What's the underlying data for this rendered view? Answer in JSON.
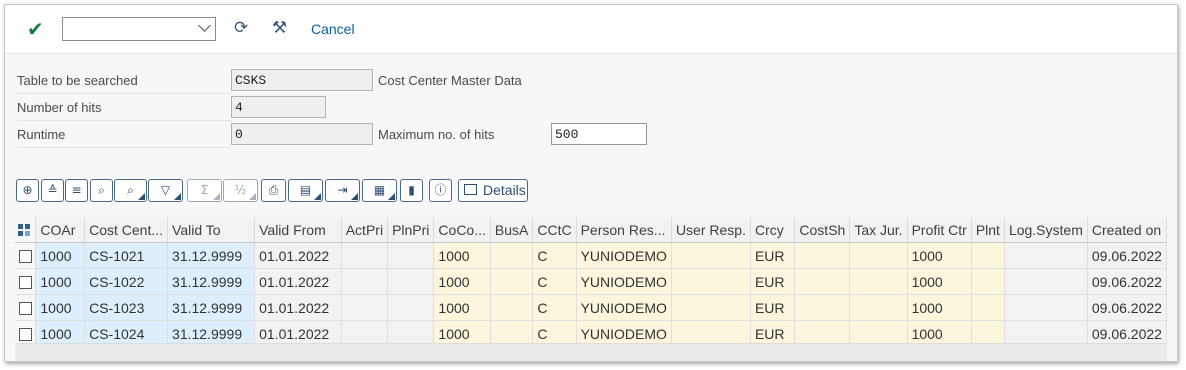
{
  "toolbar": {
    "check_glyph": "✔",
    "combo_value": "",
    "refresh_glyph": "⟳",
    "settings_glyph": "⚒",
    "cancel_label": "Cancel"
  },
  "form": {
    "table_label": "Table to be searched",
    "table_value": "CSKS",
    "table_desc": "Cost Center Master Data",
    "hits_label": "Number of hits",
    "hits_value": "4",
    "runtime_label": "Runtime",
    "runtime_value": "0",
    "maxhits_label": "Maximum no. of hits",
    "maxhits_value": "500"
  },
  "alv_toolbar": {
    "buttons": [
      {
        "icon": "zoom-icon",
        "glyph": "⊕"
      },
      {
        "icon": "sort-asc-icon",
        "glyph": "≙"
      },
      {
        "icon": "sort-desc-icon",
        "glyph": "≡"
      },
      {
        "icon": "find-icon",
        "glyph": "⌕"
      },
      {
        "icon": "find-next-icon",
        "glyph": "⌕"
      },
      {
        "icon": "filter-icon",
        "glyph": "▽"
      },
      {
        "icon": "sum-icon",
        "glyph": "Σ"
      },
      {
        "icon": "subtotal-icon",
        "glyph": "½"
      },
      {
        "icon": "print-icon",
        "glyph": "⎙"
      },
      {
        "icon": "print-preview-icon",
        "glyph": "▤"
      },
      {
        "icon": "export-icon",
        "glyph": "⇥"
      },
      {
        "icon": "layout-icon",
        "glyph": "▦"
      },
      {
        "icon": "graphic-icon",
        "glyph": "▮"
      },
      {
        "icon": "info-icon",
        "glyph": "ⓘ"
      }
    ],
    "details_label": "Details"
  },
  "table": {
    "columns": [
      "COAr",
      "Cost Cent...",
      "Valid To",
      "Valid From",
      "ActPri",
      "PlnPri",
      "CoCo...",
      "BusA",
      "CCtC",
      "Person Res...",
      "User Resp.",
      "Crcy",
      "CostSh",
      "Tax Jur.",
      "Profit Ctr",
      "Plnt",
      "Log.System",
      "Created on"
    ],
    "rows": [
      [
        "1000",
        "CS-1021",
        "31.12.9999",
        "01.01.2022",
        "",
        "",
        "1000",
        "",
        "C",
        "YUNIODEMO",
        "",
        "EUR",
        "",
        "",
        "1000",
        "",
        "",
        "09.06.2022"
      ],
      [
        "1000",
        "CS-1022",
        "31.12.9999",
        "01.01.2022",
        "",
        "",
        "1000",
        "",
        "C",
        "YUNIODEMO",
        "",
        "EUR",
        "",
        "",
        "1000",
        "",
        "",
        "09.06.2022"
      ],
      [
        "1000",
        "CS-1023",
        "31.12.9999",
        "01.01.2022",
        "",
        "",
        "1000",
        "",
        "C",
        "YUNIODEMO",
        "",
        "EUR",
        "",
        "",
        "1000",
        "",
        "",
        "09.06.2022"
      ],
      [
        "1000",
        "CS-1024",
        "31.12.9999",
        "01.01.2022",
        "",
        "",
        "1000",
        "",
        "C",
        "YUNIODEMO",
        "",
        "EUR",
        "",
        "",
        "1000",
        "",
        "",
        "09.06.2022"
      ]
    ]
  },
  "colors": {
    "key_cell": "#ddeefc",
    "yellow_cell": "#fbf6dc",
    "accent": "#0a5da8",
    "confirm": "#107e3e"
  }
}
